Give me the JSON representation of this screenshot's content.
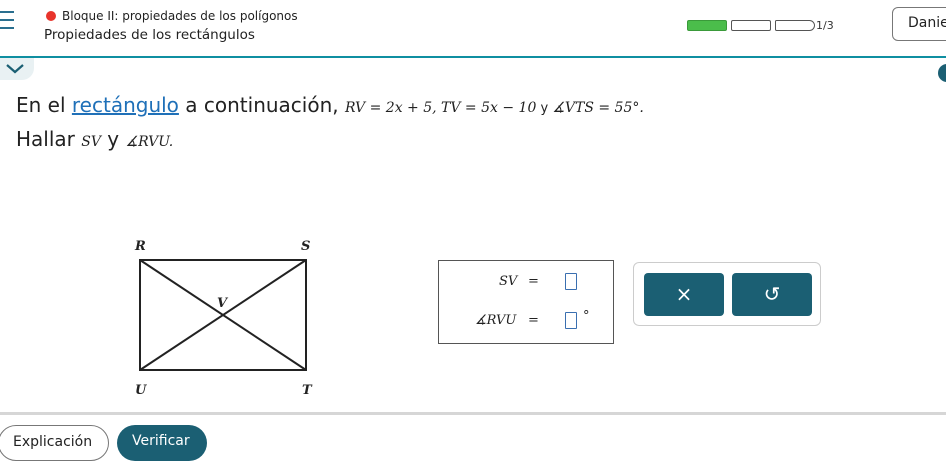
{
  "header": {
    "topic": "Bloque II: propiedades de los polígonos",
    "lesson": "Propiedades de los rectángulos",
    "progress_count": "1/3",
    "user_name": "Danie",
    "progress": {
      "segments": 3,
      "filled": 1
    }
  },
  "problem": {
    "line1_prefix": "En el ",
    "line1_link": "rectángulo",
    "line1_mid": " a continuación, ",
    "eq1": "RV = 2x + 5, TV = 5x − 10",
    "conj1": " y ",
    "eq2": "∡VTS = 55°.",
    "line2_prefix": "Hallar ",
    "find1": "SV",
    "conj2": " y ",
    "find2": "∡RVU."
  },
  "diagram": {
    "vertices": {
      "R": "R",
      "S": "S",
      "U": "U",
      "T": "T",
      "V": "V"
    }
  },
  "answers": {
    "row1_label": "SV",
    "row1_eq": "=",
    "row1_value": "",
    "row2_label": "∡RVU",
    "row2_eq": "=",
    "row2_value": "",
    "row2_unit": "°"
  },
  "tools": {
    "clear_label": "×",
    "undo_label": "↺"
  },
  "footer": {
    "explain_label": "Explicación",
    "verify_label": "Verificar"
  },
  "colors": {
    "accent": "#1b5f73",
    "teal_bar": "#0f8fa1",
    "progress_fill": "#4bbd4b",
    "alert_dot": "#e8342b",
    "link": "#1f70b8"
  }
}
